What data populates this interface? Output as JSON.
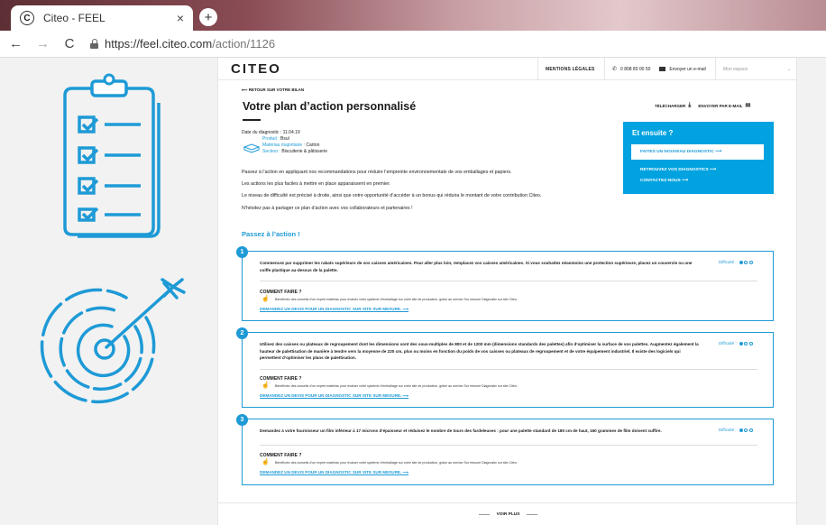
{
  "browser": {
    "tab_title": "Citeo - FEEL",
    "tab_close": "×",
    "new_tab": "+",
    "back": "←",
    "forward": "→",
    "reload": "C",
    "url_main": "https://feel.citeo.com",
    "url_path": "/action/1126"
  },
  "header": {
    "logo": "CITEO",
    "legal": "MENTIONS LÉGALES",
    "phone": "0 808 80 00 50",
    "email": "Envoyer un e-mail",
    "space_placeholder": "Mon espace",
    "space_chevron": "⌄"
  },
  "page": {
    "back_link": "⟵ RETOUR SUR VOTRE BILAN",
    "title": "Votre plan d’action personnalisé",
    "download": "TÉLÉCHARGER",
    "download_icon": "⤓",
    "send": "ENVOYER PAR E-MAIL",
    "send_icon": "✉",
    "date": "Date du diagnostic : 11.04.19",
    "product_label": "Produit :",
    "product_value": "Bsul",
    "material_label": "Matériau majoritaire :",
    "material_value": "Carton",
    "sector_label": "Secteur :",
    "sector_value": "Biscuiterie & pâtisserie",
    "intro": [
      "Passez à l’action en appliquant nos recommandations pour réduire l’empreinte environnementale de vos emballages et papiers.",
      "Les actions les plus faciles à mettre en place apparaissent en premier.",
      "Le niveau de difficulté est précisé à droite, ainsi que votre opportunité d’accéder à un bonus qui réduira le montant de votre contribution Citeo.",
      "N’hésitez pas à partager ce plan d’action avec vos collaborateurs et partenaires !"
    ],
    "cta": "Passez à l’action !",
    "voir_plus": "VOIR PLUS"
  },
  "ensuite": {
    "title": "Et ensuite ?",
    "new_diag": "FAITES UN NOUVEAU DIAGNOSTIC  ⟶",
    "find_diag": "RETROUVEZ VOS DIAGNOSTICS  ⟶",
    "contact": "CONTACTEZ-NOUS  ⟶"
  },
  "actions": [
    {
      "number": "1",
      "text": "Commencez par supprimer les rabats supérieurs de vos caisses américaines. Pour aller plus loin, remplacez vos caisses américaines. Si vous souhaitez néanmoins une protection supérieure, placez un couvercle ou une coiffe plastique au-dessus de la palette.",
      "difficulty_label": "Difficulté :",
      "difficulty_level": 1,
      "how_title": "COMMENT FAIRE ?",
      "how_text": "Bénéficiez des conseils d’un expert matériau pour évaluer votre système d’emballage sur votre site de production, grâce au service Sur mesure Diagnostic sur site Citeo.",
      "how_link": "DEMANDEZ UN DEVIS POUR UN DIAGNOSTIC SUR SITE SUR MESURE.  ⟶"
    },
    {
      "number": "2",
      "text": "Utilisez des caisses ou plateaux de regroupement dont les dimensions sont des sous-multiples de 800 et de 1200 mm (dimensions standards des palettes) afin d’optimiser la surface de vos palettes. Augmentez également la hauteur de palettisation de manière à tendre vers la moyenne de 220 cm, plus ou moins en fonction du poids de vos caisses ou plateaux de regroupement et de votre équipement industriel. Il existe des logiciels qui permettent d’optimiser les plans de palettisation.",
      "difficulty_label": "Difficulté :",
      "difficulty_level": 1,
      "how_title": "COMMENT FAIRE ?",
      "how_text": "Bénéficiez des conseils d’un expert matériau pour évaluer votre système d’emballage sur votre site de production, grâce au service Sur mesure Diagnostic sur site Citeo.",
      "how_link": "DEMANDEZ UN DEVIS POUR UN DIAGNOSTIC SUR SITE SUR MESURE.  ⟶"
    },
    {
      "number": "3",
      "text": "Demandez à votre fournisseur un film inférieur à 17 microns d’épaisseur et réduisez le nombre de tours des fardeleuses : pour une palette standard de 180 cm de haut, 160 grammes de film doivent suffire.",
      "difficulty_label": "Difficulté :",
      "difficulty_level": 1,
      "how_title": "COMMENT FAIRE ?",
      "how_text": "Bénéficiez des conseils d’un expert matériau pour évaluer votre système d’emballage sur votre site de production, grâce au service Sur mesure Diagnostic sur site Citeo.",
      "how_link": "DEMANDEZ UN DEVIS POUR UN DIAGNOSTIC SUR SITE SUR MESURE.  ⟶"
    }
  ],
  "colors": {
    "brand_blue": "#1e9ad6",
    "panel_blue": "#00a2e0"
  }
}
